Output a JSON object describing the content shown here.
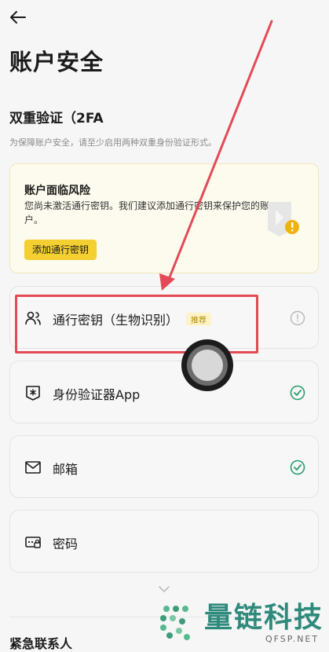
{
  "header": {
    "title": "账户安全"
  },
  "twofa": {
    "title": "双重验证（2FA",
    "description": "为保障账户安全，请至少启用两种双重身份验证形式。"
  },
  "risk": {
    "title": "账户面临风险",
    "description": "您尚未激活通行密钥。我们建议添加通行密钥来保护您的账户。",
    "button": "添加通行密钥"
  },
  "methods": [
    {
      "label": "通行密钥（生物识别）",
      "badge": "推荐",
      "icon": "passkey-users-icon",
      "status": "info"
    },
    {
      "label": "身份验证器App",
      "icon": "authenticator-shield-icon",
      "status": "enabled"
    },
    {
      "label": "邮箱",
      "icon": "mail-icon",
      "status": "enabled"
    },
    {
      "label": "密码",
      "icon": "password-lock-icon",
      "status": "none"
    }
  ],
  "emergency_contact": "紧急联系人",
  "watermark": {
    "text": "量链科技",
    "sub": "QFSP.NET"
  },
  "colors": {
    "accent": "#f3cf31",
    "success": "#2a9d6e",
    "annotation": "#e34a55"
  }
}
